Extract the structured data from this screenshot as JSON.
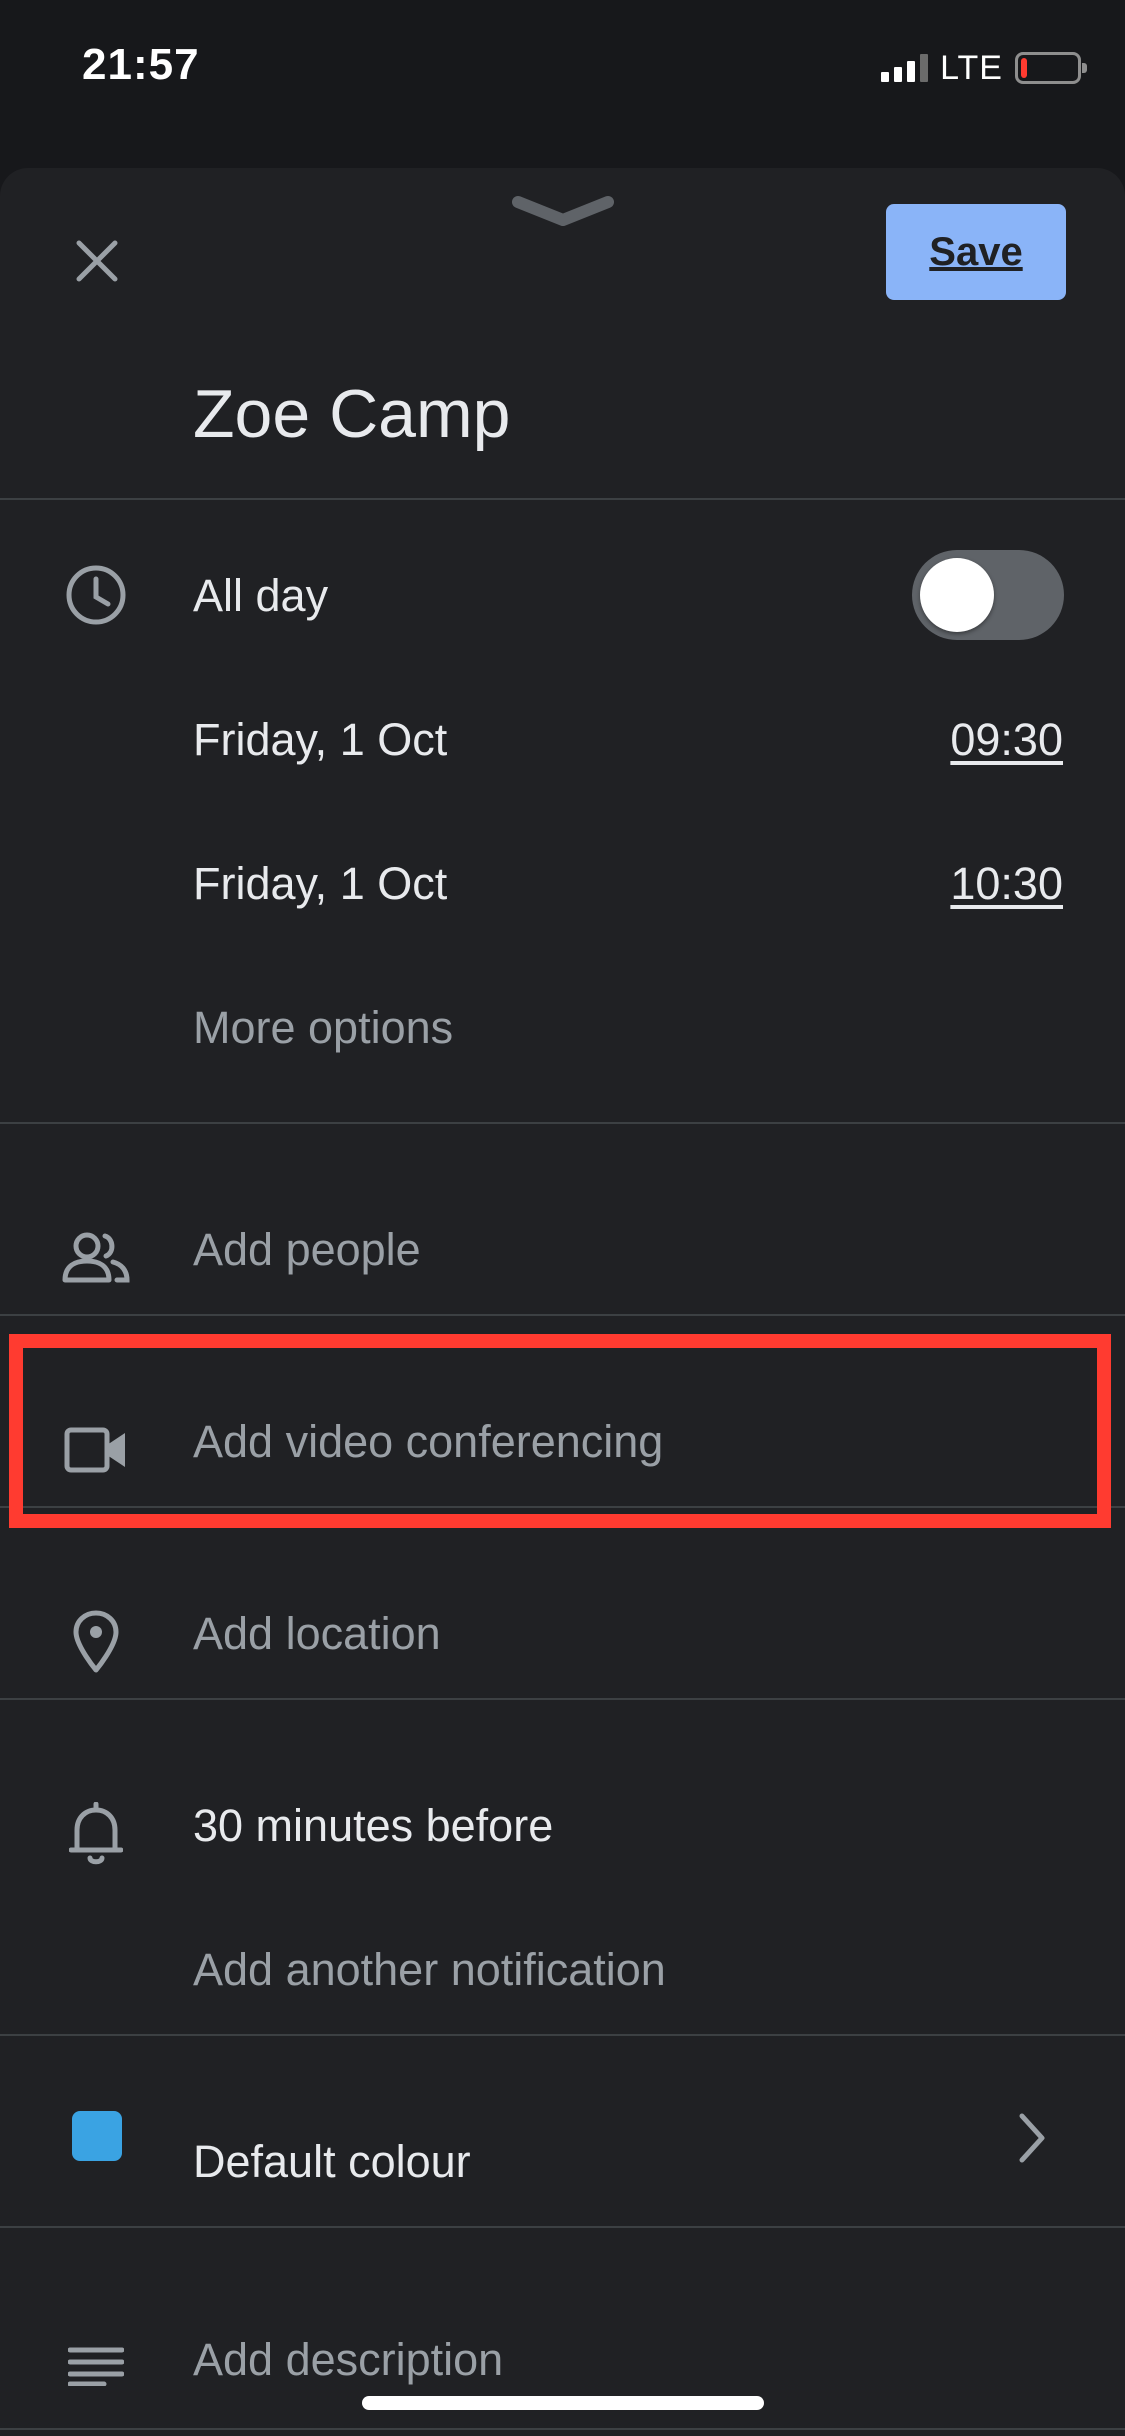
{
  "status_bar": {
    "time": "21:57",
    "network": "LTE",
    "battery_level": 0.1
  },
  "header": {
    "save_label": "Save",
    "title": "Zoe Camp"
  },
  "datetime": {
    "all_day_label": "All day",
    "all_day_on": false,
    "start_date": "Friday, 1 Oct",
    "start_time": "09:30",
    "end_date": "Friday, 1 Oct",
    "end_time": "10:30",
    "more_options": "More options"
  },
  "people": {
    "label": "Add people"
  },
  "video": {
    "label": "Add video conferencing"
  },
  "location": {
    "label": "Add location"
  },
  "notification": {
    "label": "30 minutes before",
    "add_label": "Add another notification"
  },
  "colour": {
    "label": "Default colour",
    "swatch": "#3aa3e3"
  },
  "description": {
    "label": "Add description"
  },
  "theme": {
    "accent": "#8ab4f8",
    "highlight": "#ff3b30",
    "sheet_bg": "#202124"
  },
  "icons": {
    "close": "close-icon",
    "clock": "clock-icon",
    "people": "people-icon",
    "video": "video-icon",
    "location": "location-pin-icon",
    "bell": "bell-icon",
    "description": "description-lines-icon",
    "chevron": "chevron-right-icon"
  }
}
